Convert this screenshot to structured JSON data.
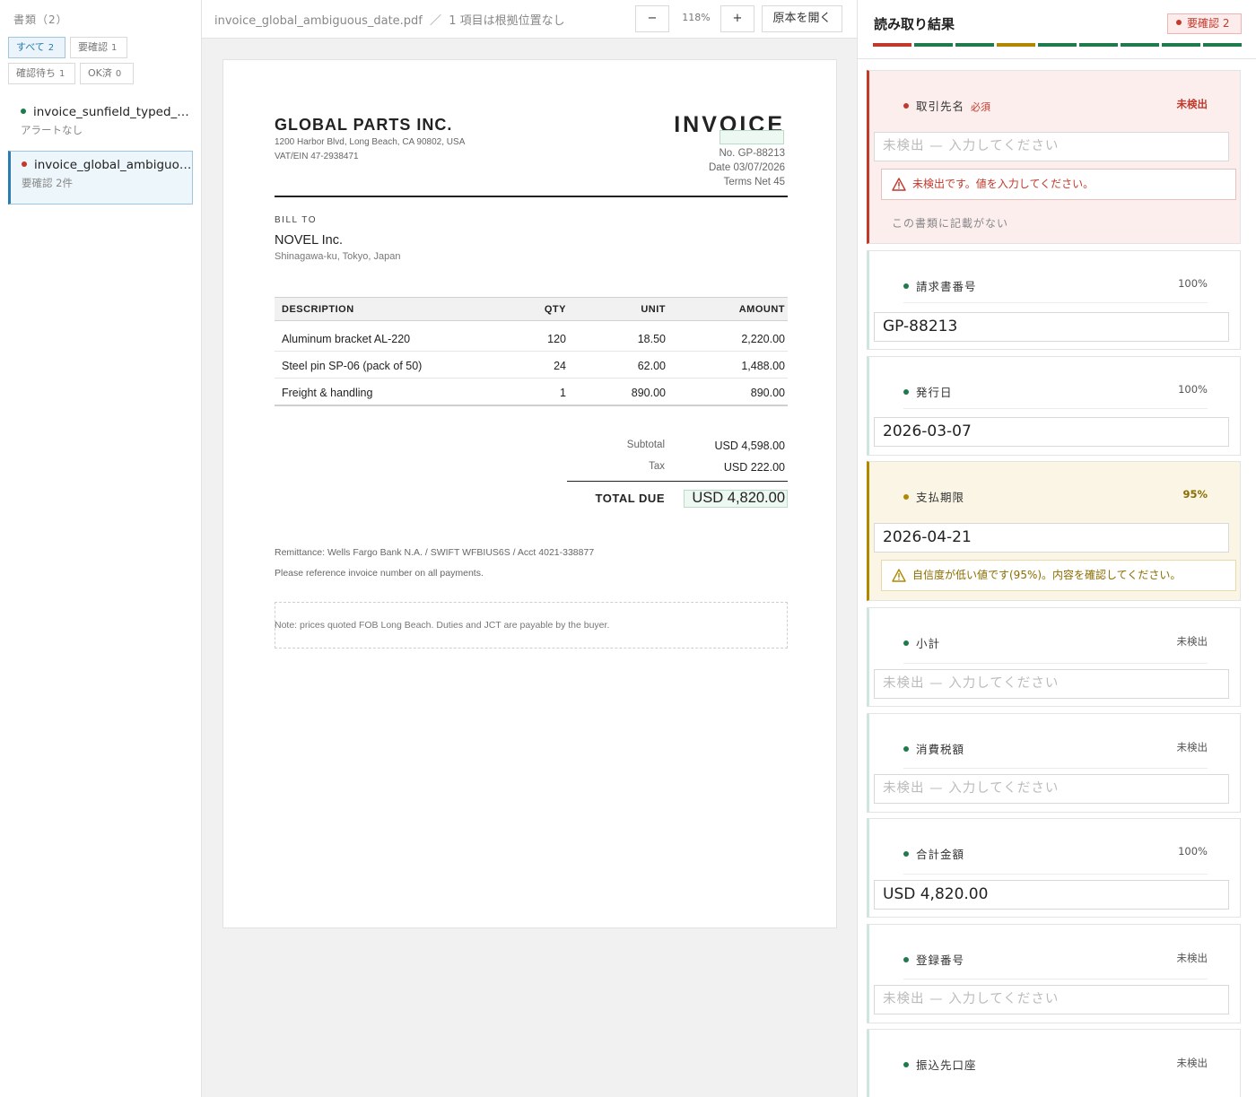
{
  "sidebar": {
    "heading": "書類（2）",
    "filters": [
      {
        "label": "すべて",
        "count": "2"
      },
      {
        "label": "要確認",
        "count": "1"
      },
      {
        "label": "確認待ち",
        "count": "1"
      },
      {
        "label": "OK済",
        "count": "0"
      }
    ],
    "docs": [
      {
        "name": "invoice_sunfield_typed_…",
        "sub": "アラートなし"
      },
      {
        "name": "invoice_global_ambiguo…",
        "sub": "要確認 2件"
      }
    ]
  },
  "toolbar": {
    "filename": "invoice_global_ambiguous_date.pdf",
    "separator": "／",
    "note": "1 項目は根拠位置なし",
    "zoom_out": "−",
    "zoom": "118%",
    "zoom_in": "+",
    "open_original": "原本を開く"
  },
  "invoice": {
    "company": "GLOBAL PARTS INC.",
    "address": "1200 Harbor Blvd, Long Beach, CA 90802, USA",
    "vat": "VAT/EIN 47-2938471",
    "title": "INVOICE",
    "no": "No. GP-88213",
    "date": "Date  03/07/2026",
    "terms": "Terms  Net 45",
    "bill_to_label": "BILL TO",
    "bill_to_name": "NOVEL Inc.",
    "bill_to_addr": "Shinagawa-ku, Tokyo, Japan",
    "columns": [
      "DESCRIPTION",
      "QTY",
      "UNIT",
      "AMOUNT"
    ],
    "rows": [
      [
        "Aluminum bracket AL-220",
        "120",
        "18.50",
        "2,220.00"
      ],
      [
        "Steel pin SP-06 (pack of 50)",
        "24",
        "62.00",
        "1,488.00"
      ],
      [
        "Freight & handling",
        "1",
        "890.00",
        "890.00"
      ]
    ],
    "subtotal_label": "Subtotal",
    "subtotal": "USD 4,598.00",
    "tax_label": "Tax",
    "tax": "USD 222.00",
    "total_label": "TOTAL DUE",
    "total": "USD 4,820.00",
    "remittance": "Remittance:  Wells Fargo Bank N.A. / SWIFT WFBIUS6S / Acct 4021-338877",
    "reference": "Please reference invoice number on all payments.",
    "note": "Note: prices quoted FOB Long Beach. Duties and JCT are payable by the buyer."
  },
  "panel": {
    "title": "読み取り結果",
    "badge": "要確認  2",
    "fields": [
      {
        "label": "取引先名",
        "required": "必須",
        "status": "未検出",
        "value": "",
        "placeholder": "未検出 — 入力してください",
        "alert": "未検出です。値を入力してください。",
        "extra": "この書類に記載がない"
      },
      {
        "label": "請求書番号",
        "status": "100%",
        "value": "GP-88213"
      },
      {
        "label": "発行日",
        "status": "100%",
        "value": "2026-03-07"
      },
      {
        "label": "支払期限",
        "status": "95%",
        "value": "2026-04-21",
        "alert": "自信度が低い値です(95%)。内容を確認してください。"
      },
      {
        "label": "小計",
        "status": "未検出",
        "placeholder": "未検出 — 入力してください"
      },
      {
        "label": "消費税額",
        "status": "未検出",
        "placeholder": "未検出 — 入力してください"
      },
      {
        "label": "合計金額",
        "status": "100%",
        "value": "USD 4,820.00"
      },
      {
        "label": "登録番号",
        "status": "未検出",
        "placeholder": "未検出 — 入力してください"
      },
      {
        "label": "振込先口座",
        "status": "未検出"
      }
    ]
  },
  "colors": {
    "error": "#c0392b",
    "warning": "#b08800",
    "ok": "#1f7a4d",
    "accent": "#2a7cb0"
  }
}
